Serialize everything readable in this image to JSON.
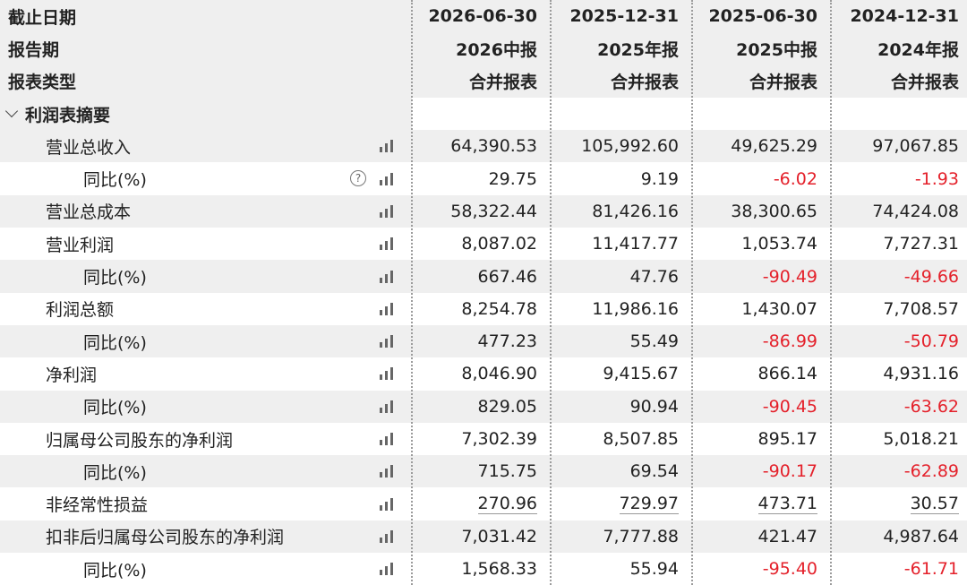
{
  "header": {
    "rows": [
      {
        "label": "截止日期",
        "values": [
          "2026-06-30",
          "2025-12-31",
          "2025-06-30",
          "2024-12-31"
        ]
      },
      {
        "label": "报告期",
        "values": [
          "2026中报",
          "2025年报",
          "2025中报",
          "2024年报"
        ]
      },
      {
        "label": "报表类型",
        "values": [
          "合并报表",
          "合并报表",
          "合并报表",
          "合并报表"
        ]
      }
    ]
  },
  "section": {
    "label": "利润表摘要",
    "icon": "chevron-down-icon"
  },
  "rows": [
    {
      "label": "营业总收入",
      "indent": 1,
      "values": [
        "64,390.53",
        "105,992.60",
        "49,625.29",
        "97,067.85"
      ]
    },
    {
      "label": "同比(%)",
      "indent": 2,
      "help": true,
      "values": [
        "29.75",
        "9.19",
        "-6.02",
        "-1.93"
      ]
    },
    {
      "label": "营业总成本",
      "indent": 1,
      "values": [
        "58,322.44",
        "81,426.16",
        "38,300.65",
        "74,424.08"
      ]
    },
    {
      "label": "营业利润",
      "indent": 1,
      "values": [
        "8,087.02",
        "11,417.77",
        "1,053.74",
        "7,727.31"
      ]
    },
    {
      "label": "同比(%)",
      "indent": 2,
      "values": [
        "667.46",
        "47.76",
        "-90.49",
        "-49.66"
      ]
    },
    {
      "label": "利润总额",
      "indent": 1,
      "values": [
        "8,254.78",
        "11,986.16",
        "1,430.07",
        "7,708.57"
      ]
    },
    {
      "label": "同比(%)",
      "indent": 2,
      "values": [
        "477.23",
        "55.49",
        "-86.99",
        "-50.79"
      ]
    },
    {
      "label": "净利润",
      "indent": 1,
      "values": [
        "8,046.90",
        "9,415.67",
        "866.14",
        "4,931.16"
      ]
    },
    {
      "label": "同比(%)",
      "indent": 2,
      "values": [
        "829.05",
        "90.94",
        "-90.45",
        "-63.62"
      ]
    },
    {
      "label": "归属母公司股东的净利润",
      "indent": 1,
      "values": [
        "7,302.39",
        "8,507.85",
        "895.17",
        "5,018.21"
      ]
    },
    {
      "label": "同比(%)",
      "indent": 2,
      "values": [
        "715.75",
        "69.54",
        "-90.17",
        "-62.89"
      ]
    },
    {
      "label": "非经常性损益",
      "indent": 1,
      "underline": true,
      "values": [
        "270.96",
        "729.97",
        "473.71",
        "30.57"
      ]
    },
    {
      "label": "扣非后归属母公司股东的净利润",
      "indent": 1,
      "values": [
        "7,031.42",
        "7,777.88",
        "421.47",
        "4,987.64"
      ]
    },
    {
      "label": "同比(%)",
      "indent": 2,
      "values": [
        "1,568.33",
        "55.94",
        "-95.40",
        "-61.71"
      ]
    }
  ],
  "colors": {
    "negative": "#e4212b",
    "stripe": "#efefef",
    "text": "#222222"
  },
  "icons": {
    "row_chart": "bar-chart-icon",
    "help": "help-circle-icon"
  }
}
